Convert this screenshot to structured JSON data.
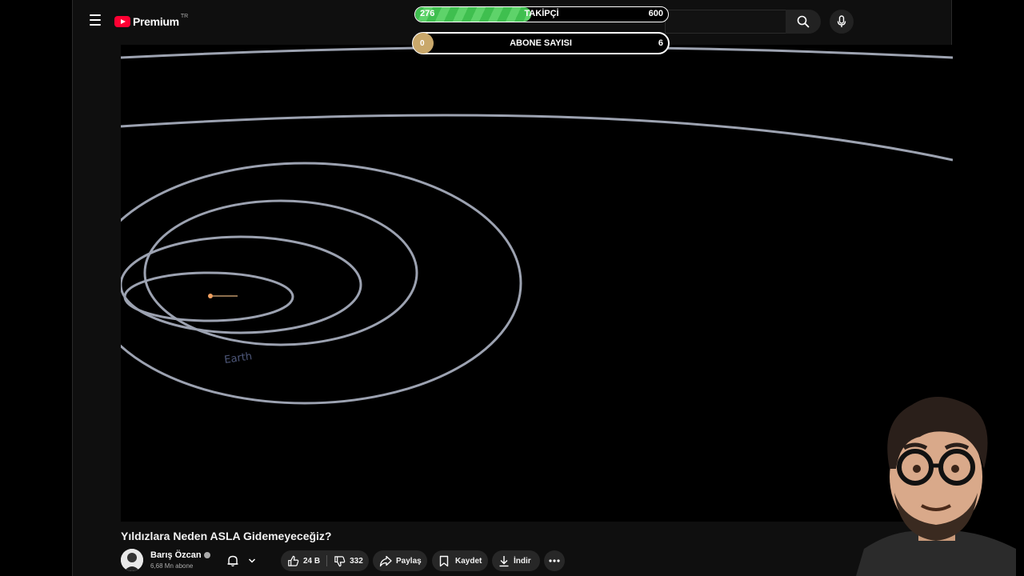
{
  "header": {
    "logo_text": "Premium",
    "logo_country": "TR"
  },
  "overlay": {
    "followers": {
      "current": "276",
      "label": "TAKİPÇİ",
      "max": "600",
      "progress_fraction": 0.46
    },
    "subscribers": {
      "current": "0",
      "label": "ABONE SAYISI",
      "max": "6",
      "progress_fraction": 0.0
    }
  },
  "video": {
    "title": "Yıldızlara Neden ASLA Gidemeyeceğiz?",
    "scene_label": "Earth"
  },
  "channel": {
    "name": "Barış Özcan",
    "subscribers": "6,68 Mn abone"
  },
  "actions": {
    "like_count": "24 B",
    "dislike_count": "332",
    "share_label": "Paylaş",
    "save_label": "Kaydet",
    "download_label": "İndir"
  },
  "colors": {
    "progress_green": "#4cc95a",
    "knob_gold": "#c9a86b",
    "brand_red": "#ff0033"
  }
}
